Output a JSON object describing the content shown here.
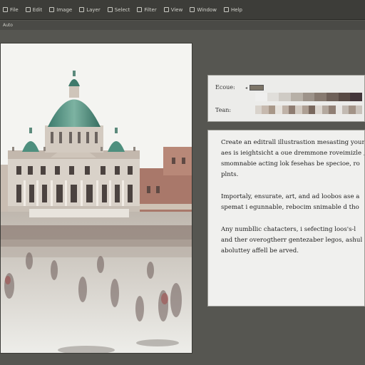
{
  "toolbar": {
    "items": [
      "File",
      "Edit",
      "Image",
      "Layer",
      "Select",
      "Filter",
      "View",
      "Window",
      "Help"
    ]
  },
  "options_bar": {
    "label": "Auto"
  },
  "swatches": {
    "label_top": "Ecoue:",
    "label_bottom": "Tean:",
    "chip_color": "#7c7467",
    "top_row": [
      "#efefee",
      "#e0deda",
      "#cfcbc5",
      "#b7b0a7",
      "#9d938a",
      "#877a70",
      "#6e6058",
      "#584a44",
      "#43363a"
    ],
    "bottom_row": [
      "#d9d3cc",
      "#c6b9ae",
      "#a89788",
      "#e6e2dc",
      "#bfb2a7",
      "#8e7c71",
      "#d2cac1",
      "#ad9f93",
      "#79685d",
      "#dcd6cf",
      "#b3a89e",
      "#907f74",
      "#e8e6e3",
      "#c2bab2",
      "#a29387",
      "#c9c2bb"
    ]
  },
  "text_panel": {
    "lines_p1": [
      "Create an editrall illustrastion mesasting your E",
      "aes is ieightsicht a oue dremmone roveimizle ,",
      "smomnabie acting lok fesehas be specioe, ro",
      "plnts."
    ],
    "lines_p2": [
      "Importaly, ensurate, art, and ad loobos ase a",
      "spemat i egunnable, rebocim snimable d tho"
    ],
    "lines_p3": [
      "Any numbllic chatacters, i sefecting loos's-l",
      "and ther overogtherr gentezaber legos, ashul",
      "aboluttey affell be arved."
    ]
  }
}
